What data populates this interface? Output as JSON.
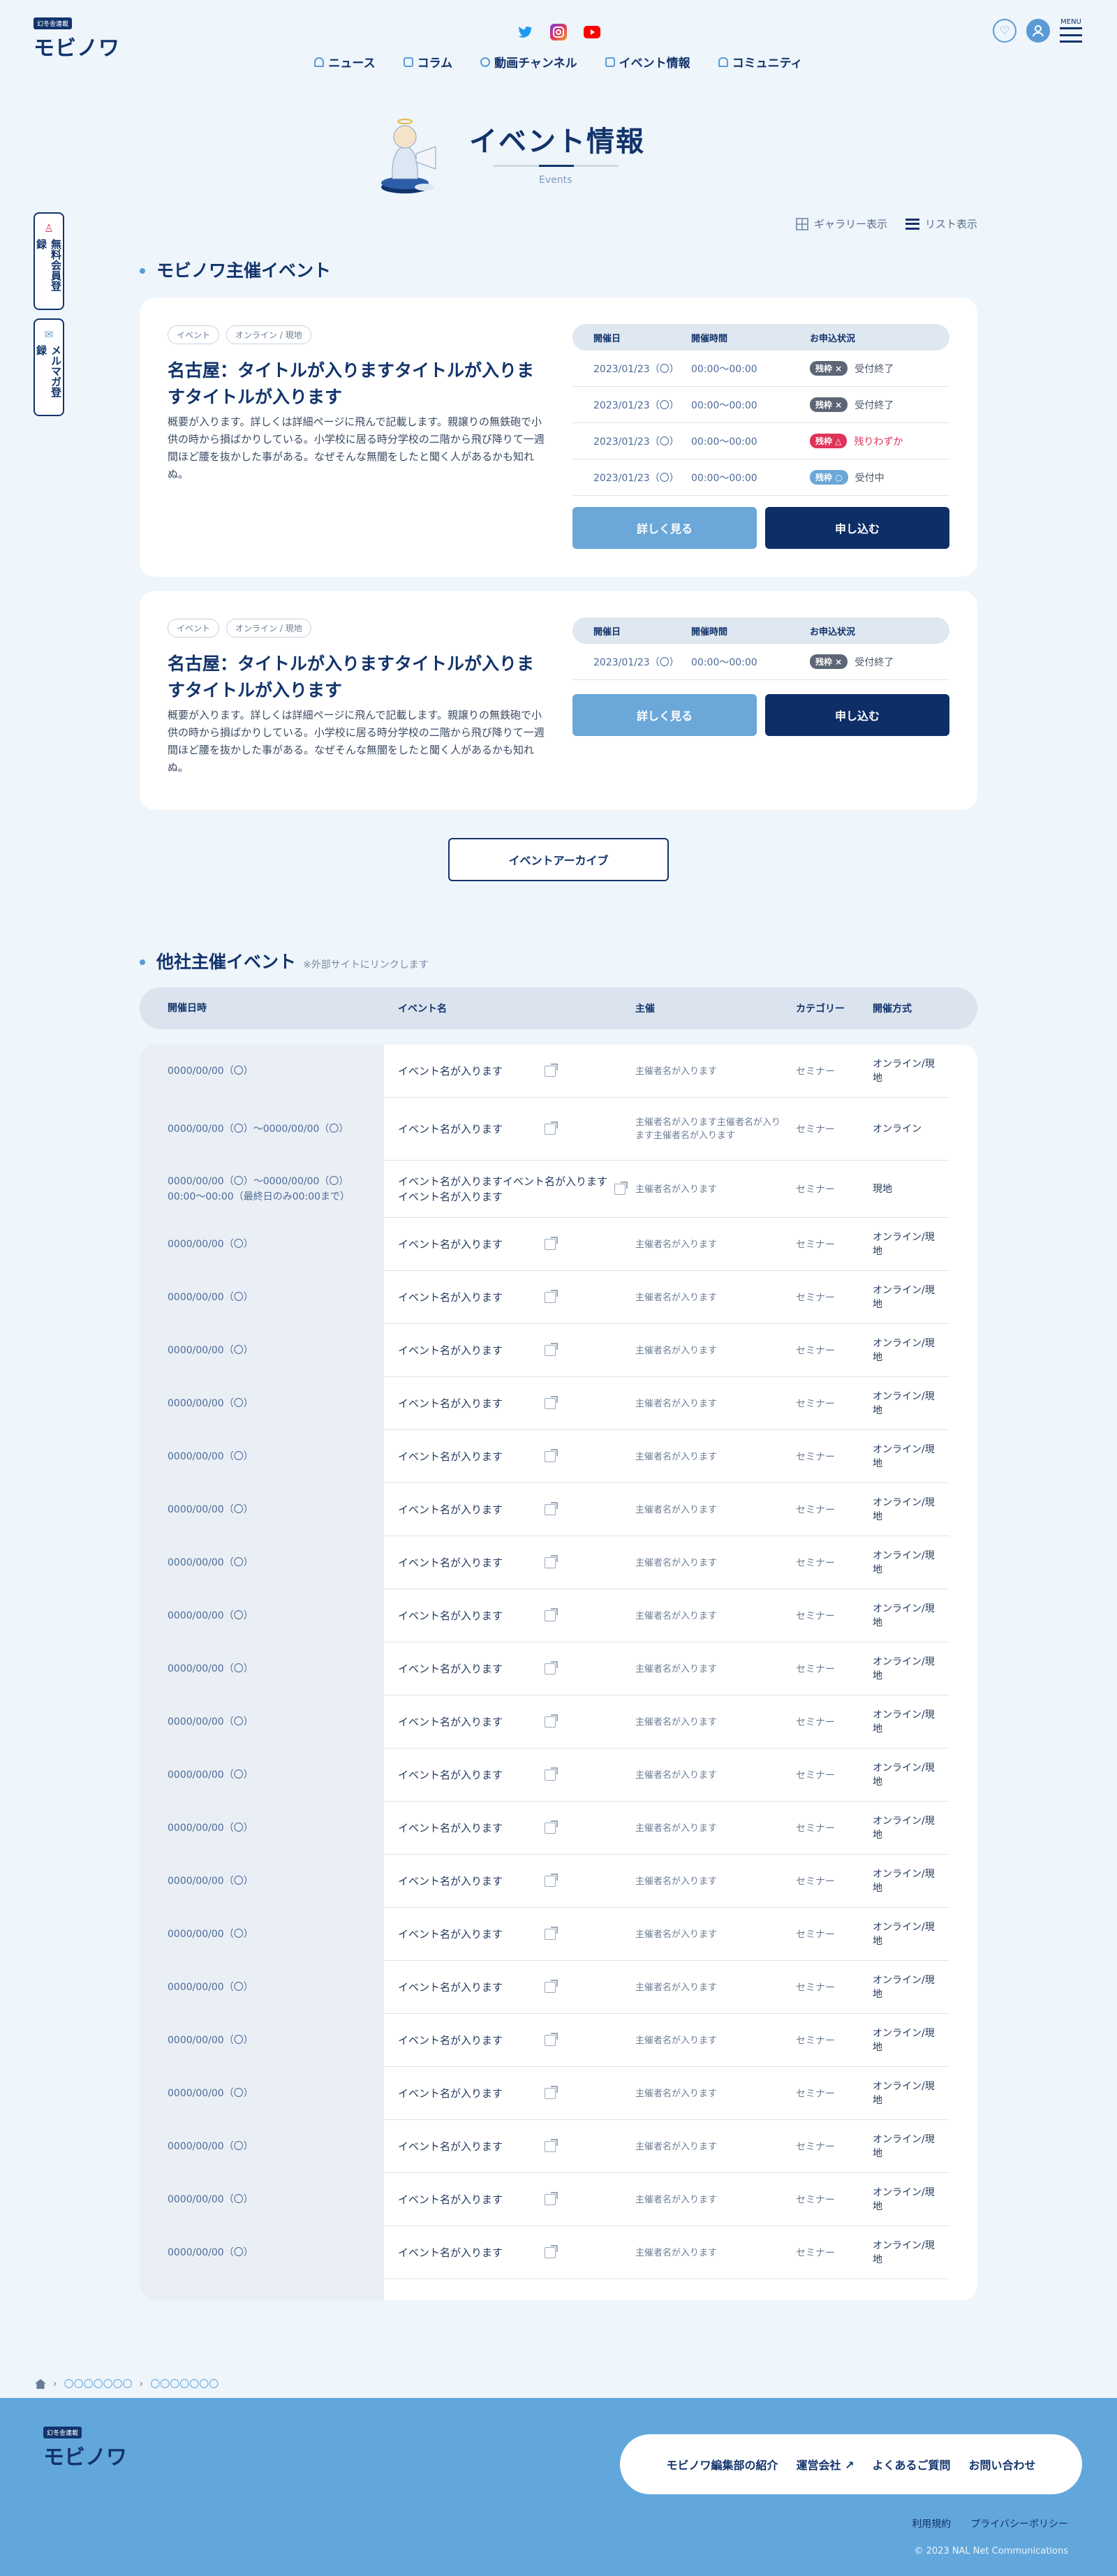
{
  "header": {
    "logo_tag": "幻冬舎連載",
    "logo_name": "モビノワ",
    "nav": [
      "ニュース",
      "コラム",
      "動画チャンネル",
      "イベント情報",
      "コミュニティ"
    ],
    "menu_label": "MENU"
  },
  "sidetabs": [
    "無料会員登録",
    "メルマガ登録"
  ],
  "hero": {
    "title": "イベント情報",
    "subtitle": "Events"
  },
  "view_toggle": {
    "gallery": "ギャラリー表示",
    "list": "リスト表示"
  },
  "own_events": {
    "heading": "モビノワ主催イベント",
    "table_headers": {
      "date": "開催日",
      "time": "開催時間",
      "status": "お申込状況"
    },
    "detail_button": "詳しく見る",
    "apply_button": "申し込む",
    "cards": [
      {
        "tags": [
          "イベント",
          "オンライン / 現地"
        ],
        "title": "名古屋：タイトルが入りますタイトルが入りますタイトルが入ります",
        "desc": "概要が入ります。詳しくは詳細ページに飛んで記載します。親譲りの無鉄砲で小供の時から損ばかりしている。小学校に居る時分学校の二階から飛び降りて一週間ほど腰を抜かした事がある。なぜそんな無闇をしたと聞く人があるかも知れぬ。",
        "rows": [
          {
            "date": "2023/01/23（〇）",
            "time": "00:00〜00:00",
            "badge": "残枠 ×",
            "badge_color": "grey",
            "status": "受付終了"
          },
          {
            "date": "2023/01/23（〇）",
            "time": "00:00〜00:00",
            "badge": "残枠 ×",
            "badge_color": "grey",
            "status": "受付終了"
          },
          {
            "date": "2023/01/23（〇）",
            "time": "00:00〜00:00",
            "badge": "残枠 △",
            "badge_color": "red",
            "status": "残りわずか"
          },
          {
            "date": "2023/01/23（〇）",
            "time": "00:00〜00:00",
            "badge": "残枠 ○",
            "badge_color": "blue",
            "status": "受付中"
          }
        ]
      },
      {
        "tags": [
          "イベント",
          "オンライン / 現地"
        ],
        "title": "名古屋：タイトルが入りますタイトルが入りますタイトルが入ります",
        "desc": "概要が入ります。詳しくは詳細ページに飛んで記載します。親譲りの無鉄砲で小供の時から損ばかりしている。小学校に居る時分学校の二階から飛び降りて一週間ほど腰を抜かした事がある。なぜそんな無闇をしたと聞く人があるかも知れぬ。",
        "rows": [
          {
            "date": "2023/01/23（〇）",
            "time": "00:00〜00:00",
            "badge": "残枠 ×",
            "badge_color": "grey",
            "status": "受付終了"
          }
        ]
      }
    ],
    "archive_button": "イベントアーカイブ"
  },
  "other_events": {
    "heading": "他社主催イベント",
    "note": "※外部サイトにリンクします",
    "headers": [
      "開催日時",
      "イベント名",
      "主催",
      "カテゴリー",
      "開催方式"
    ],
    "rows": [
      {
        "date": "0000/00/00（〇）",
        "name": "イベント名が入ります",
        "org": "主催者名が入ります",
        "cat": "セミナー",
        "mode": "オンライン/現地"
      },
      {
        "date": "0000/00/00（〇）〜0000/00/00（〇）",
        "name": "イベント名が入ります",
        "org": "主催者名が入ります主催者名が入ります主催者名が入ります",
        "cat": "セミナー",
        "mode": "オンライン"
      },
      {
        "date": "0000/00/00（〇）〜0000/00/00（〇）00:00〜00:00（最終日のみ00:00まで）",
        "name": "イベント名が入りますイベント名が入りますイベント名が入ります",
        "org": "主催者名が入ります",
        "cat": "セミナー",
        "mode": "現地"
      },
      {
        "date": "0000/00/00（〇）",
        "name": "イベント名が入ります",
        "org": "主催者名が入ります",
        "cat": "セミナー",
        "mode": "オンライン/現地"
      },
      {
        "date": "0000/00/00（〇）",
        "name": "イベント名が入ります",
        "org": "主催者名が入ります",
        "cat": "セミナー",
        "mode": "オンライン/現地"
      },
      {
        "date": "0000/00/00（〇）",
        "name": "イベント名が入ります",
        "org": "主催者名が入ります",
        "cat": "セミナー",
        "mode": "オンライン/現地"
      },
      {
        "date": "0000/00/00（〇）",
        "name": "イベント名が入ります",
        "org": "主催者名が入ります",
        "cat": "セミナー",
        "mode": "オンライン/現地"
      },
      {
        "date": "0000/00/00（〇）",
        "name": "イベント名が入ります",
        "org": "主催者名が入ります",
        "cat": "セミナー",
        "mode": "オンライン/現地"
      },
      {
        "date": "0000/00/00（〇）",
        "name": "イベント名が入ります",
        "org": "主催者名が入ります",
        "cat": "セミナー",
        "mode": "オンライン/現地"
      },
      {
        "date": "0000/00/00（〇）",
        "name": "イベント名が入ります",
        "org": "主催者名が入ります",
        "cat": "セミナー",
        "mode": "オンライン/現地"
      },
      {
        "date": "0000/00/00（〇）",
        "name": "イベント名が入ります",
        "org": "主催者名が入ります",
        "cat": "セミナー",
        "mode": "オンライン/現地"
      },
      {
        "date": "0000/00/00（〇）",
        "name": "イベント名が入ります",
        "org": "主催者名が入ります",
        "cat": "セミナー",
        "mode": "オンライン/現地"
      },
      {
        "date": "0000/00/00（〇）",
        "name": "イベント名が入ります",
        "org": "主催者名が入ります",
        "cat": "セミナー",
        "mode": "オンライン/現地"
      },
      {
        "date": "0000/00/00（〇）",
        "name": "イベント名が入ります",
        "org": "主催者名が入ります",
        "cat": "セミナー",
        "mode": "オンライン/現地"
      },
      {
        "date": "0000/00/00（〇）",
        "name": "イベント名が入ります",
        "org": "主催者名が入ります",
        "cat": "セミナー",
        "mode": "オンライン/現地"
      },
      {
        "date": "0000/00/00（〇）",
        "name": "イベント名が入ります",
        "org": "主催者名が入ります",
        "cat": "セミナー",
        "mode": "オンライン/現地"
      },
      {
        "date": "0000/00/00（〇）",
        "name": "イベント名が入ります",
        "org": "主催者名が入ります",
        "cat": "セミナー",
        "mode": "オンライン/現地"
      },
      {
        "date": "0000/00/00（〇）",
        "name": "イベント名が入ります",
        "org": "主催者名が入ります",
        "cat": "セミナー",
        "mode": "オンライン/現地"
      },
      {
        "date": "0000/00/00（〇）",
        "name": "イベント名が入ります",
        "org": "主催者名が入ります",
        "cat": "セミナー",
        "mode": "オンライン/現地"
      },
      {
        "date": "0000/00/00（〇）",
        "name": "イベント名が入ります",
        "org": "主催者名が入ります",
        "cat": "セミナー",
        "mode": "オンライン/現地"
      },
      {
        "date": "0000/00/00（〇）",
        "name": "イベント名が入ります",
        "org": "主催者名が入ります",
        "cat": "セミナー",
        "mode": "オンライン/現地"
      },
      {
        "date": "0000/00/00（〇）",
        "name": "イベント名が入ります",
        "org": "主催者名が入ります",
        "cat": "セミナー",
        "mode": "オンライン/現地"
      },
      {
        "date": "0000/00/00（〇）",
        "name": "イベント名が入ります",
        "org": "主催者名が入ります",
        "cat": "セミナー",
        "mode": "オンライン/現地"
      }
    ]
  },
  "breadcrumb": [
    "〇〇〇〇〇〇〇",
    "〇〇〇〇〇〇〇"
  ],
  "footer": {
    "logo_tag": "幻冬舎連載",
    "logo_name": "モビノワ",
    "nav": [
      "モビノワ編集部の紹介",
      "運営会社",
      "よくあるご質問",
      "お問い合わせ"
    ],
    "links": [
      "利用規約",
      "プライバシーポリシー"
    ],
    "copyright": "© 2023 NAL Net Communications"
  },
  "colors": {
    "navy": "#12336b",
    "accent": "#5b9bd5",
    "footer": "#62a7dc",
    "alert": "#e0335a"
  }
}
